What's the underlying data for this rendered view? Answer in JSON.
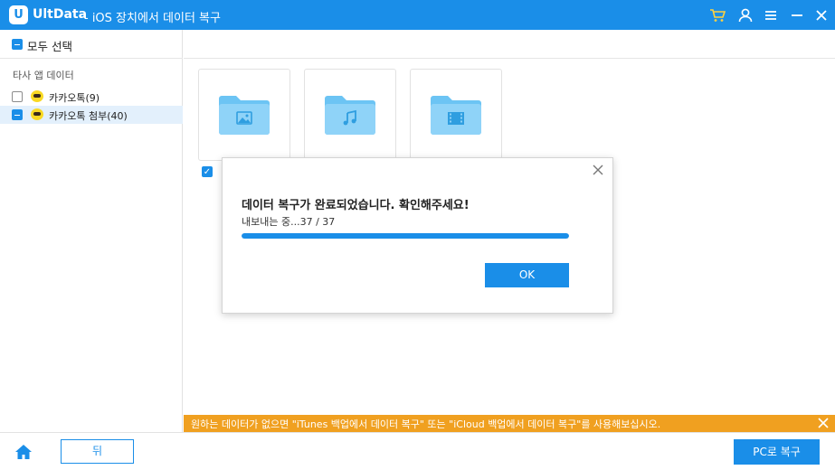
{
  "titlebar": {
    "logo_letter": "U",
    "app_name": "UltData",
    "subtitle": "- iOS 장치에서 데이터 복구",
    "icons": [
      "cart-icon",
      "user-icon",
      "menu-icon",
      "minimize-icon",
      "close-icon"
    ]
  },
  "sidebar": {
    "select_all_label": "모두 선택",
    "section_label": "타사 앱 데이터",
    "items": [
      {
        "label": "카카오톡(9)",
        "checked": false,
        "icon": "kakaotalk-icon"
      },
      {
        "label": "카카오톡 첨부(40)",
        "checked": "partial",
        "icon": "kakaotalk-icon"
      }
    ]
  },
  "main": {
    "tiles": [
      {
        "icon": "image-folder-icon"
      },
      {
        "icon": "music-folder-icon"
      },
      {
        "icon": "video-folder-icon"
      }
    ]
  },
  "dialog": {
    "title": "데이터 복구가 완료되었습니다. 확인해주세요!",
    "progress_text": "내보내는 중...37 / 37",
    "progress": 1.0,
    "ok_label": "OK"
  },
  "banner": {
    "text": "원하는 데이터가 없으면 \"iTunes 백업에서 데이터 복구\" 또는 \"iCloud 백업에서 데이터 복구\"를 사용해보십시오."
  },
  "footer": {
    "back_label": "뒤",
    "recover_label": "PC로 복구"
  },
  "colors": {
    "accent": "#1a8ee8",
    "banner": "#f0a020",
    "folder": "#6cc4f4",
    "kakao": "#f9d923"
  }
}
